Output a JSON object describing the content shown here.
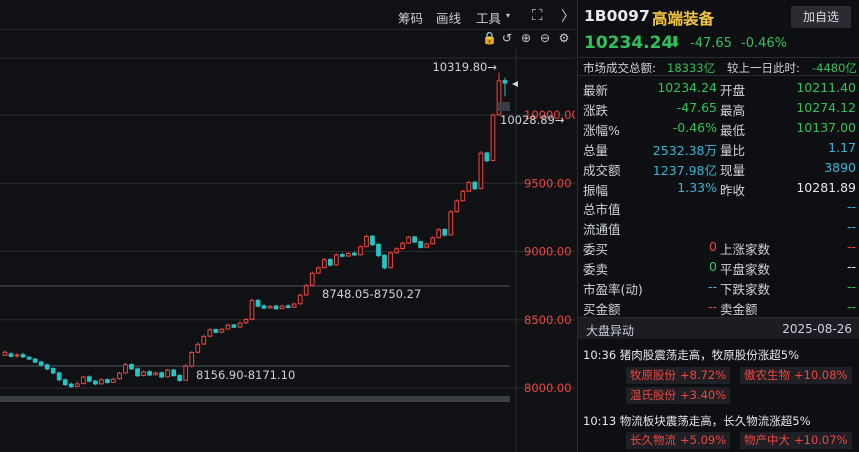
{
  "toolbar": {
    "chouma": "筹码",
    "huaxian": "画线",
    "tools": "工具",
    "tools_arrow": "▾",
    "expand_icon": "expand-icon",
    "collapse_icon": "chevron-right-icon"
  },
  "chart_icons": [
    "lock-icon",
    "undo-icon",
    "zoom-in-icon",
    "zoom-out-icon",
    "settings-icon"
  ],
  "chart_data": {
    "type": "candlestick",
    "y_ticks": [
      "10000.00",
      "9500.00",
      "9000.00",
      "8500.00",
      "8000.00"
    ],
    "ylim": [
      7920,
      10420
    ],
    "annotations": {
      "high": "10319.80→",
      "low_recent": "10028.89→",
      "mid_range": "8748.05-8750.27",
      "low_range": "8156.90-8171.10"
    },
    "candles": [
      [
        8240,
        8262,
        8248,
        8275
      ],
      [
        8250,
        8232,
        8225,
        8260
      ],
      [
        8235,
        8242,
        8222,
        8255
      ],
      [
        8245,
        8228,
        8220,
        8258
      ],
      [
        8226,
        8212,
        8205,
        8232
      ],
      [
        8212,
        8190,
        8182,
        8220
      ],
      [
        8190,
        8168,
        8160,
        8200
      ],
      [
        8170,
        8140,
        8130,
        8178
      ],
      [
        8142,
        8110,
        8100,
        8150
      ],
      [
        8110,
        8060,
        8050,
        8120
      ],
      [
        8060,
        8025,
        8015,
        8070
      ],
      [
        8028,
        8010,
        8002,
        8040
      ],
      [
        8012,
        8030,
        8008,
        8048
      ],
      [
        8032,
        8080,
        8028,
        8090
      ],
      [
        8082,
        8050,
        8042,
        8092
      ],
      [
        8050,
        8030,
        8020,
        8060
      ],
      [
        8030,
        8060,
        8028,
        8072
      ],
      [
        8062,
        8040,
        8032,
        8070
      ],
      [
        8042,
        8065,
        8038,
        8075
      ],
      [
        8068,
        8108,
        8062,
        8120
      ],
      [
        8110,
        8170,
        8105,
        8185
      ],
      [
        8172,
        8140,
        8132,
        8180
      ],
      [
        8140,
        8090,
        8080,
        8150
      ],
      [
        8092,
        8118,
        8085,
        8128
      ],
      [
        8120,
        8095,
        8088,
        8130
      ],
      [
        8097,
        8110,
        8090,
        8122
      ],
      [
        8112,
        8080,
        8075,
        8120
      ],
      [
        8082,
        8130,
        8078,
        8140
      ],
      [
        8132,
        8090,
        8085,
        8140
      ],
      [
        8092,
        8055,
        8045,
        8100
      ],
      [
        8057,
        8160,
        8052,
        8175
      ],
      [
        8162,
        8260,
        8150,
        8270
      ],
      [
        8262,
        8320,
        8255,
        8335
      ],
      [
        8322,
        8378,
        8315,
        8392
      ],
      [
        8380,
        8425,
        8370,
        8440
      ],
      [
        8428,
        8408,
        8400,
        8435
      ],
      [
        8410,
        8430,
        8402,
        8440
      ],
      [
        8432,
        8460,
        8428,
        8472
      ],
      [
        8462,
        8445,
        8438,
        8470
      ],
      [
        8447,
        8475,
        8440,
        8486
      ],
      [
        8477,
        8502,
        8470,
        8512
      ],
      [
        8504,
        8640,
        8495,
        8655
      ],
      [
        8642,
        8600,
        8590,
        8650
      ],
      [
        8602,
        8585,
        8578,
        8612
      ],
      [
        8587,
        8598,
        8580,
        8608
      ],
      [
        8600,
        8580,
        8574,
        8610
      ],
      [
        8582,
        8600,
        8576,
        8610
      ],
      [
        8602,
        8590,
        8582,
        8612
      ],
      [
        8592,
        8615,
        8586,
        8625
      ],
      [
        8617,
        8680,
        8610,
        8692
      ],
      [
        8682,
        8750,
        8675,
        8762
      ],
      [
        8752,
        8840,
        8745,
        8852
      ],
      [
        8842,
        8880,
        8835,
        8892
      ],
      [
        8882,
        8940,
        8876,
        8952
      ],
      [
        8942,
        8900,
        8892,
        8950
      ],
      [
        8902,
        8975,
        8895,
        8985
      ],
      [
        8977,
        8965,
        8958,
        8990
      ],
      [
        8967,
        8985,
        8960,
        8995
      ],
      [
        8987,
        8975,
        8968,
        8998
      ],
      [
        8977,
        9035,
        8970,
        9045
      ],
      [
        9037,
        9110,
        9030,
        9125
      ],
      [
        9112,
        9050,
        9040,
        9120
      ],
      [
        9052,
        8970,
        8960,
        9060
      ],
      [
        8972,
        8880,
        8870,
        8980
      ],
      [
        8882,
        8990,
        8875,
        9000
      ],
      [
        8992,
        9020,
        8985,
        9032
      ],
      [
        9022,
        9060,
        9015,
        9072
      ],
      [
        9062,
        9105,
        9055,
        9115
      ],
      [
        9107,
        9070,
        9060,
        9115
      ],
      [
        9072,
        9030,
        9022,
        9080
      ],
      [
        9032,
        9055,
        9025,
        9065
      ],
      [
        9057,
        9100,
        9050,
        9112
      ],
      [
        9102,
        9160,
        9095,
        9172
      ],
      [
        9162,
        9120,
        9110,
        9170
      ],
      [
        9122,
        9290,
        9115,
        9305
      ],
      [
        9292,
        9370,
        9285,
        9382
      ],
      [
        9372,
        9440,
        9365,
        9452
      ],
      [
        9442,
        9505,
        9435,
        9518
      ],
      [
        9507,
        9460,
        9450,
        9515
      ],
      [
        9462,
        9720,
        9455,
        9735
      ],
      [
        9722,
        9665,
        9655,
        9730
      ],
      [
        9667,
        10000,
        9660,
        10010
      ],
      [
        10002,
        10250,
        9995,
        10310
      ],
      [
        10252,
        10234,
        10137,
        10274
      ]
    ]
  },
  "stock": {
    "code": "1B0097",
    "name": "高端装备",
    "add_watch": "加自选",
    "price": "10234.24",
    "arrow": "🡇",
    "change": "-47.65",
    "pct": "-0.46%"
  },
  "market": {
    "label": "市场成交总额:",
    "value": "18333亿",
    "cmp_label": "较上一日此时:",
    "cmp_value": "-4480亿"
  },
  "quote_rows": [
    {
      "l": "最新",
      "v": "10234.24",
      "vc": "g",
      "l2": "开盘",
      "v2": "10211.40",
      "v2c": "g"
    },
    {
      "l": "涨跌",
      "v": "-47.65",
      "vc": "g",
      "l2": "最高",
      "v2": "10274.12",
      "v2c": "g"
    },
    {
      "l": "涨幅%",
      "v": "-0.46%",
      "vc": "g",
      "l2": "最低",
      "v2": "10137.00",
      "v2c": "g"
    },
    {
      "l": "总量",
      "v": "2532.38万",
      "vc": "c",
      "l2": "量比",
      "v2": "1.17",
      "v2c": "c"
    },
    {
      "l": "成交额",
      "v": "1237.98亿",
      "vc": "c",
      "l2": "现量",
      "v2": "3890",
      "v2c": "c"
    },
    {
      "l": "振幅",
      "v": "1.33%",
      "vc": "c",
      "l2": "昨收",
      "v2": "10281.89",
      "v2c": "w"
    },
    {
      "l": "总市值",
      "v": "",
      "vc": "c",
      "l2": "",
      "v2": "--",
      "v2c": "c"
    },
    {
      "l": "流通值",
      "v": "",
      "vc": "c",
      "l2": "",
      "v2": "--",
      "v2c": "c"
    },
    {
      "l": "委买",
      "v": "0",
      "vc": "r",
      "l2": "上涨家数",
      "v2": "--",
      "v2c": "r"
    },
    {
      "l": "委卖",
      "v": "0",
      "vc": "g",
      "l2": "平盘家数",
      "v2": "--",
      "v2c": "w"
    },
    {
      "l": "市盈率(动)",
      "v": "--",
      "vc": "c",
      "l2": "下跌家数",
      "v2": "--",
      "v2c": "g"
    },
    {
      "l": "买金额",
      "v": "--",
      "vc": "r",
      "l2": "卖金额",
      "v2": "--",
      "v2c": "g"
    }
  ],
  "news": {
    "title": "大盘异动",
    "date": "2025-08-26",
    "item1": "10:36 猪肉股震荡走高，牧原股份涨超5%",
    "item1_tags": [
      {
        "name": "牧原股份",
        "pct": "+8.72%"
      },
      {
        "name": "傲农生物",
        "pct": "+10.08%"
      },
      {
        "name": "温氏股份",
        "pct": "+3.40%"
      }
    ],
    "item2": "10:13 物流板块震荡走高，长久物流涨超5%",
    "item2_tags": [
      {
        "name": "长久物流",
        "pct": "+5.09%"
      },
      {
        "name": "物产中大",
        "pct": "+10.07%"
      }
    ]
  }
}
